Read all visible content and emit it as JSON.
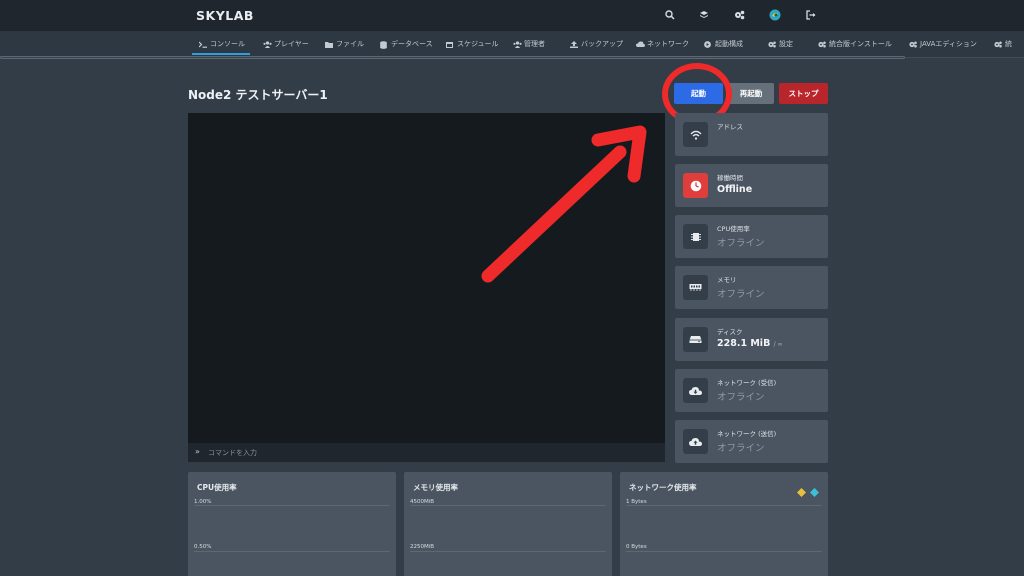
{
  "app": {
    "brand": "SKYLAB"
  },
  "topbar": {
    "icons": [
      "search-icon",
      "layers-icon",
      "cogs-icon",
      "avatar-icon",
      "sign-out-icon"
    ]
  },
  "nav": {
    "items": [
      {
        "label": "コンソール",
        "icon": "terminal-icon"
      },
      {
        "label": "プレイヤー",
        "icon": "users-icon"
      },
      {
        "label": "ファイル",
        "icon": "folder-icon"
      },
      {
        "label": "データベース",
        "icon": "database-icon"
      },
      {
        "label": "スケジュール",
        "icon": "calendar-icon"
      },
      {
        "label": "管理者",
        "icon": "admins-icon"
      },
      {
        "label": "バックアップ",
        "icon": "upload-icon"
      },
      {
        "label": "ネットワーク",
        "icon": "network-icon"
      },
      {
        "label": "起動構成",
        "icon": "play-circle-icon"
      },
      {
        "label": "設定",
        "icon": "cogs-icon"
      },
      {
        "label": "統合版インストール",
        "icon": "cogs-icon"
      },
      {
        "label": "JAVAエディション",
        "icon": "cogs-icon"
      },
      {
        "label": "統",
        "icon": "cogs-icon"
      }
    ]
  },
  "server": {
    "title": "Node2 テストサーバー1"
  },
  "buttons": {
    "start": "起動",
    "restart": "再起動",
    "stop": "ストップ"
  },
  "console": {
    "placeholder": "コマンドを入力"
  },
  "stats": [
    {
      "label": "アドレス",
      "value": "",
      "icon": "wifi-icon"
    },
    {
      "label": "稼働時間",
      "value": "Offline",
      "icon": "clock-icon"
    },
    {
      "label": "CPU使用率",
      "value": "オフライン",
      "icon": "cpu-icon"
    },
    {
      "label": "メモリ",
      "value": "オフライン",
      "icon": "memory-icon"
    },
    {
      "label": "ディスク",
      "value": "228.1 MiB",
      "value_sub": "/ ∞",
      "icon": "hdd-icon"
    },
    {
      "label": "ネットワーク (受信)",
      "value": "オフライン",
      "icon": "cloud-download-icon"
    },
    {
      "label": "ネットワーク (送信)",
      "value": "オフライン",
      "icon": "cloud-upload-icon"
    }
  ],
  "graphs": [
    {
      "title": "CPU使用率",
      "ticks": [
        "1.00%",
        "0.50%"
      ]
    },
    {
      "title": "メモリ使用率",
      "ticks": [
        "4500MiB",
        "2250MiB"
      ]
    },
    {
      "title": "ネットワーク使用率",
      "ticks": [
        "1 Bytes",
        "0 Bytes"
      ]
    }
  ],
  "colors": {
    "accent": "#2f9fd9",
    "start": "#2d6ae6",
    "restart": "#66707a",
    "stop": "#b8262b",
    "annotation": "#ee2a2a",
    "uptime_icon_bg": "#e03d3d"
  }
}
